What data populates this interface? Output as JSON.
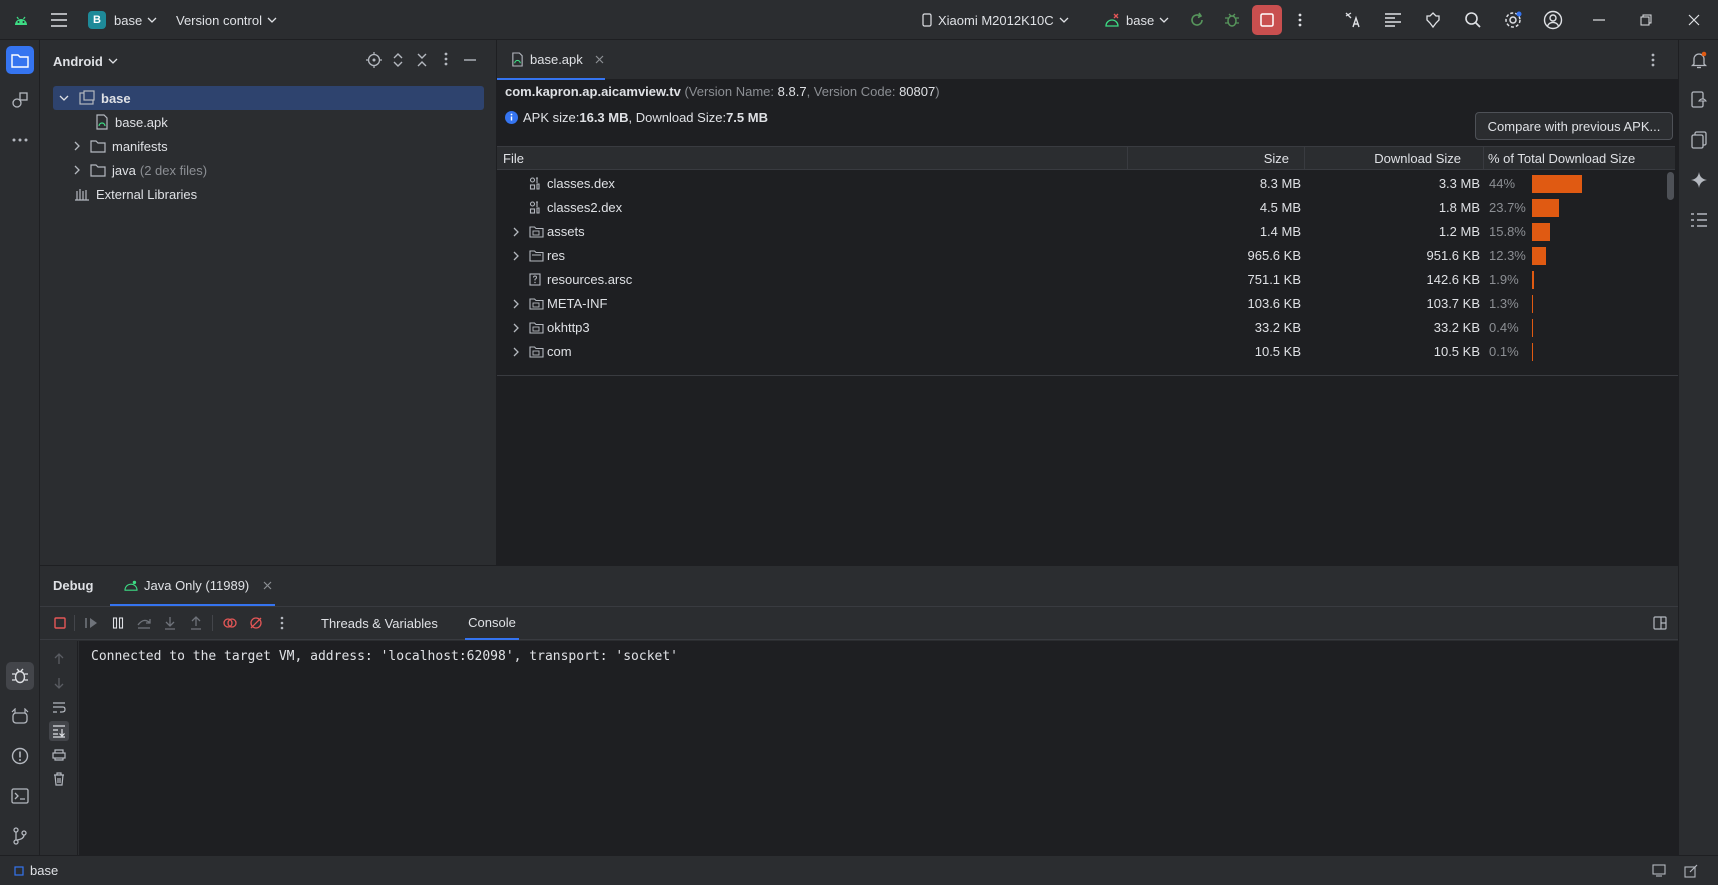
{
  "titlebar": {
    "project_badge": "B",
    "project_name": "base",
    "vcs_label": "Version control",
    "device": "Xiaomi M2012K10C",
    "run_config": "base"
  },
  "project_panel": {
    "view_label": "Android",
    "tree": [
      {
        "label": "base",
        "suffix": "",
        "icon": "module-icon",
        "expanded": true,
        "selected": true
      },
      {
        "label": "base.apk",
        "suffix": "",
        "icon": "apk-file-icon"
      },
      {
        "label": "manifests",
        "suffix": "",
        "icon": "folder-icon",
        "expandable": true
      },
      {
        "label": "java",
        "suffix": "(2 dex files)",
        "icon": "folder-icon",
        "expandable": true
      },
      {
        "label": "External Libraries",
        "suffix": "",
        "icon": "libraries-icon"
      }
    ]
  },
  "editor": {
    "tab_label": "base.apk",
    "package": "com.kapron.ap.aicamview.tv",
    "version_name_label": "(Version Name: ",
    "version_name": "8.8.7",
    "version_code_label": ", Version Code: ",
    "version_code": "80807",
    "version_close": ")",
    "apk_size_label": "APK size: ",
    "apk_size": "16.3 MB",
    "download_size_label": ", Download Size: ",
    "download_size": "7.5 MB",
    "compare_button": "Compare with previous APK...",
    "columns": {
      "file": "File",
      "size": "Size",
      "download_size": "Download Size",
      "percent": "% of Total Download Size"
    },
    "rows": [
      {
        "name": "classes.dex",
        "size": "8.3 MB",
        "download": "3.3 MB",
        "percent": "44%",
        "pct_value": 44,
        "icon": "dex-file-icon",
        "expandable": false
      },
      {
        "name": "classes2.dex",
        "size": "4.5 MB",
        "download": "1.8 MB",
        "percent": "23.7%",
        "pct_value": 23.7,
        "icon": "dex-file-icon",
        "expandable": false
      },
      {
        "name": "assets",
        "size": "1.4 MB",
        "download": "1.2 MB",
        "percent": "15.8%",
        "pct_value": 15.8,
        "icon": "folder-icon",
        "expandable": true
      },
      {
        "name": "res",
        "size": "965.6 KB",
        "download": "951.6 KB",
        "percent": "12.3%",
        "pct_value": 12.3,
        "icon": "res-folder-icon",
        "expandable": true
      },
      {
        "name": "resources.arsc",
        "size": "751.1 KB",
        "download": "142.6 KB",
        "percent": "1.9%",
        "pct_value": 1.9,
        "icon": "unknown-file-icon",
        "expandable": false
      },
      {
        "name": "META-INF",
        "size": "103.6 KB",
        "download": "103.7 KB",
        "percent": "1.3%",
        "pct_value": 1.3,
        "icon": "folder-icon",
        "expandable": true
      },
      {
        "name": "okhttp3",
        "size": "33.2 KB",
        "download": "33.2 KB",
        "percent": "0.4%",
        "pct_value": 0.4,
        "icon": "folder-icon",
        "expandable": true
      },
      {
        "name": "com",
        "size": "10.5 KB",
        "download": "10.5 KB",
        "percent": "0.1%",
        "pct_value": 0.1,
        "icon": "folder-icon",
        "expandable": true
      }
    ]
  },
  "debug": {
    "title": "Debug",
    "session_tab": "Java Only (11989)",
    "subtabs": [
      "Threads & Variables",
      "Console"
    ],
    "console_line": "Connected to the target VM, address: 'localhost:62098', transport: 'socket'"
  },
  "statusbar": {
    "breadcrumb": "base"
  },
  "colors": {
    "accent": "#3574f0",
    "bar": "#e05a12",
    "stop": "#c94f4f",
    "android_green": "#3ddc84"
  }
}
